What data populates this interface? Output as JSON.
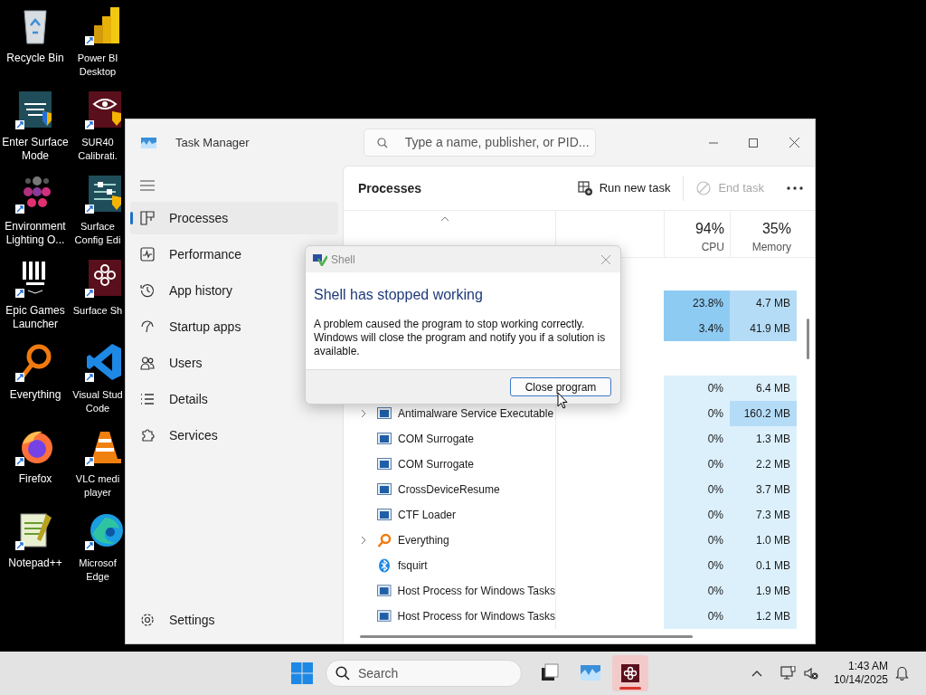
{
  "desktop_icons": [
    {
      "label": "Recycle Bin"
    },
    {
      "label": "Power BI\nDesktop"
    },
    {
      "label": "Enter Surface\nMode"
    },
    {
      "label": "SUR40\nCalibrati."
    },
    {
      "label": "Environment\nLighting O..."
    },
    {
      "label": "Surface\nConfig Edi"
    },
    {
      "label": "Epic Games\nLauncher"
    },
    {
      "label": "Surface Sh"
    },
    {
      "label": "Everything"
    },
    {
      "label": "Visual Stud\nCode"
    },
    {
      "label": "Firefox"
    },
    {
      "label": "VLC medi\nplayer"
    },
    {
      "label": "Notepad++"
    },
    {
      "label": "Microsof\nEdge"
    }
  ],
  "window": {
    "title": "Task Manager",
    "search": {
      "placeholder": "Type a name, publisher, or PID..."
    }
  },
  "sidebar": {
    "items": [
      {
        "label": "Processes",
        "selected": true
      },
      {
        "label": "Performance",
        "selected": false
      },
      {
        "label": "App history",
        "selected": false
      },
      {
        "label": "Startup apps",
        "selected": false
      },
      {
        "label": "Users",
        "selected": false
      },
      {
        "label": "Details",
        "selected": false
      },
      {
        "label": "Services",
        "selected": false
      }
    ],
    "settings": "Settings"
  },
  "page": {
    "title": "Processes",
    "actions": [
      {
        "label": "Run new task",
        "disabled": false
      },
      {
        "label": "End task",
        "disabled": true
      }
    ]
  },
  "table": {
    "columns": [
      {
        "label": "CPU",
        "total": "94%"
      },
      {
        "label": "Memory",
        "total": "35%"
      }
    ],
    "rows": [
      {
        "kind": "group"
      },
      {
        "kind": "process",
        "cpu": {
          "text": "23.8%",
          "color": "#8ecbf3"
        },
        "memory": {
          "text": "4.7 MB",
          "color": "#b5dcf7"
        }
      },
      {
        "kind": "process",
        "cpu": {
          "text": "3.4%",
          "color": "#8ecbf3"
        },
        "memory": {
          "text": "41.9 MB",
          "color": "#b5dcf7"
        }
      },
      {
        "kind": "group"
      },
      {
        "kind": "process",
        "cpu": {
          "text": "0%",
          "color": "#dcf0fc"
        },
        "memory": {
          "text": "6.4 MB",
          "color": "#dcf0fc"
        }
      },
      {
        "kind": "process",
        "name": "Antimalware Service Executable",
        "has_children": true,
        "cpu": {
          "text": "0%",
          "color": "#dcf0fc"
        },
        "memory": {
          "text": "160.2 MB",
          "color": "#b5dcf7"
        }
      },
      {
        "kind": "process",
        "name": "COM Surrogate",
        "has_children": false,
        "cpu": {
          "text": "0%",
          "color": "#dcf0fc"
        },
        "memory": {
          "text": "1.3 MB",
          "color": "#dcf0fc"
        }
      },
      {
        "kind": "process",
        "name": "COM Surrogate",
        "has_children": false,
        "cpu": {
          "text": "0%",
          "color": "#dcf0fc"
        },
        "memory": {
          "text": "2.2 MB",
          "color": "#dcf0fc"
        }
      },
      {
        "kind": "process",
        "name": "CrossDeviceResume",
        "has_children": false,
        "cpu": {
          "text": "0%",
          "color": "#dcf0fc"
        },
        "memory": {
          "text": "3.7 MB",
          "color": "#dcf0fc"
        }
      },
      {
        "kind": "process",
        "name": "CTF Loader",
        "has_children": false,
        "cpu": {
          "text": "0%",
          "color": "#dcf0fc"
        },
        "memory": {
          "text": "7.3 MB",
          "color": "#dcf0fc"
        }
      },
      {
        "kind": "process",
        "name": "Everything",
        "has_children": true,
        "cpu": {
          "text": "0%",
          "color": "#dcf0fc"
        },
        "memory": {
          "text": "1.0 MB",
          "color": "#dcf0fc"
        }
      },
      {
        "kind": "process",
        "name": "fsquirt",
        "has_children": false,
        "cpu": {
          "text": "0%",
          "color": "#dcf0fc"
        },
        "memory": {
          "text": "0.1 MB",
          "color": "#dcf0fc"
        }
      },
      {
        "kind": "process",
        "name": "Host Process for Windows Tasks",
        "has_children": false,
        "cpu": {
          "text": "0%",
          "color": "#dcf0fc"
        },
        "memory": {
          "text": "1.9 MB",
          "color": "#dcf0fc"
        }
      },
      {
        "kind": "process",
        "name": "Host Process for Windows Tasks",
        "has_children": false,
        "cpu": {
          "text": "0%",
          "color": "#dcf0fc"
        },
        "memory": {
          "text": "1.2 MB",
          "color": "#dcf0fc"
        }
      }
    ]
  },
  "dialog": {
    "title": "Shell",
    "heading": "Shell has stopped working",
    "message": "A problem caused the program to stop working correctly. Windows will close the program and notify you if a solution is available.",
    "button": "Close program"
  },
  "taskbar": {
    "search": "Search",
    "apps": [
      {
        "selected": false
      },
      {
        "selected": false
      },
      {
        "selected": true
      }
    ],
    "time": "1:43 AM",
    "date": "10/14/2025"
  }
}
